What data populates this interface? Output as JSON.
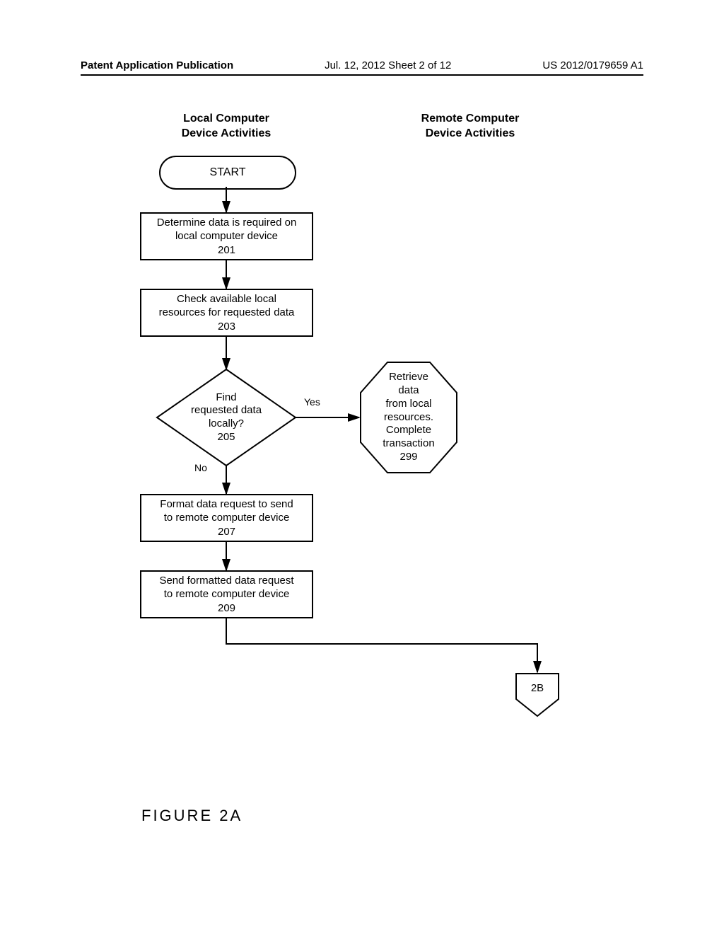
{
  "header": {
    "left": "Patent Application Publication",
    "center": "Jul. 12, 2012  Sheet 2 of 12",
    "right": "US 2012/0179659 A1"
  },
  "columns": {
    "local_heading": "Local Computer\nDevice Activities",
    "remote_heading": "Remote Computer\nDevice Activities"
  },
  "nodes": {
    "start": "START",
    "n201": {
      "text": "Determine data is required on\nlocal computer device",
      "ref": "201"
    },
    "n203": {
      "text": "Check available local\nresources for requested data",
      "ref": "203"
    },
    "n205": {
      "text": "Find\nrequested data\nlocally?",
      "ref": "205"
    },
    "n299": {
      "text": "Retrieve\ndata\nfrom local\nresources.\nComplete\ntransaction",
      "ref": "299"
    },
    "n207": {
      "text": "Format data request to send\nto remote computer device",
      "ref": "207"
    },
    "n209": {
      "text": "Send formatted data request\nto remote computer device",
      "ref": "209"
    },
    "offpage": "2B"
  },
  "edge_labels": {
    "yes": "Yes",
    "no": "No"
  },
  "figure_label": "FIGURE  2A"
}
